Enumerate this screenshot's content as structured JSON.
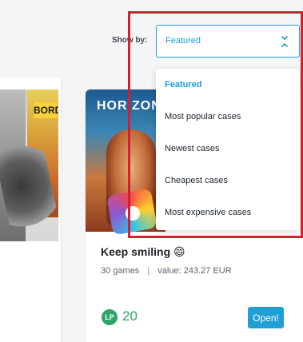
{
  "sort": {
    "label": "Show by:",
    "selected": "Featured",
    "options": [
      "Featured",
      "Most popular cases",
      "Newest cases",
      "Cheapest cases",
      "Most expensive cases"
    ]
  },
  "left_card": {
    "art_text": "BORD"
  },
  "case": {
    "cover_title": "HORIZON",
    "name": "Keep smiling 😄",
    "games": "30 games",
    "separator": "|",
    "value": "value: 243.27 EUR",
    "lp_badge": "LP",
    "lp_value": "20",
    "open_label": "Open!"
  },
  "colors": {
    "accent": "#1f9fd6",
    "points_green": "#2ea66a",
    "highlight_red": "#d32030"
  }
}
